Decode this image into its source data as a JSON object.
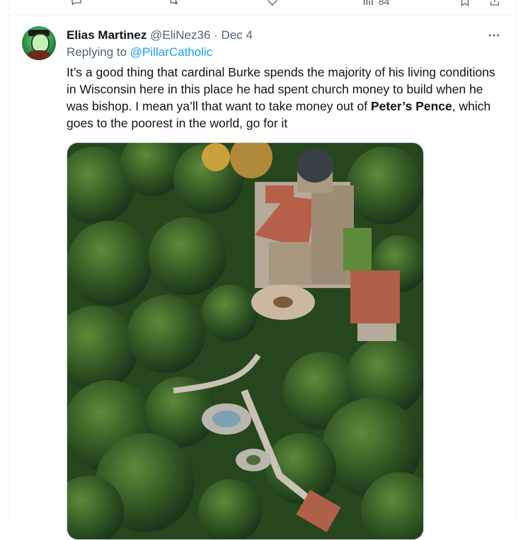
{
  "previous_actions": {
    "reply_icon": "comment-icon",
    "repost_icon": "repost-icon",
    "like_icon": "heart-icon",
    "views_count": "84",
    "views_icon": "chart-icon",
    "bookmark_icon": "bookmark-icon",
    "share_icon": "share-icon"
  },
  "tweet": {
    "author_name": "Elias Martinez",
    "handle": "@EliNez36",
    "separator": "·",
    "date": "Dec 4",
    "replying_prefix": "Replying to",
    "replying_to": "@PillarCatholic",
    "text_part1": "It’s a good thing that cardinal Burke spends the majority of his living conditions in Wisconsin here in this place he had spent church money to build when he was bishop. I mean ya’ll that want to take money out of ",
    "text_bold": "Peter’s Pence",
    "text_part2": ", which goes to the poorest in the world, go for it",
    "more_icon": "more-icon",
    "media_description_icon": "photo-aerial-shrine"
  },
  "colors": {
    "text": "#0f1419",
    "secondary": "#536471",
    "link": "#1d9bf0",
    "border": "#eff3f4"
  }
}
